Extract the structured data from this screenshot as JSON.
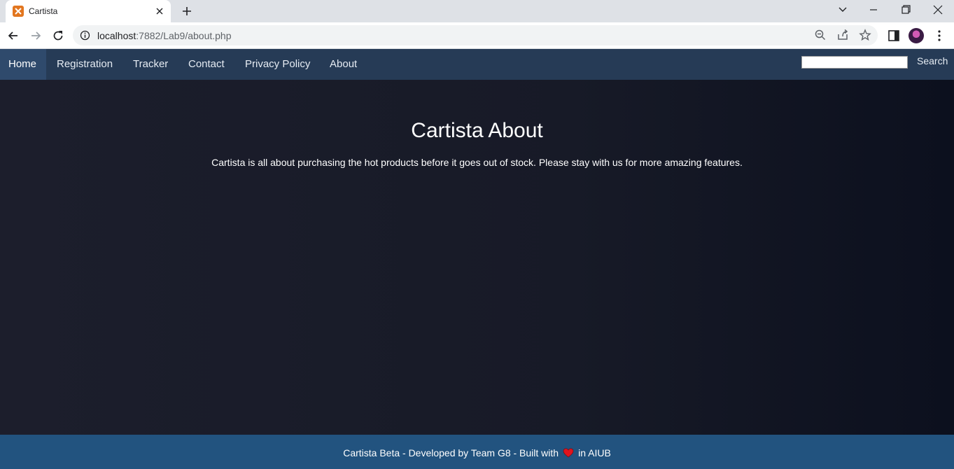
{
  "browser": {
    "tab_title": "Cartista",
    "url_host": "localhost",
    "url_rest": ":7882/Lab9/about.php"
  },
  "nav": {
    "items": [
      {
        "label": "Home"
      },
      {
        "label": "Registration"
      },
      {
        "label": "Tracker"
      },
      {
        "label": "Contact"
      },
      {
        "label": "Privacy Policy"
      },
      {
        "label": "About"
      }
    ],
    "active": "Home",
    "search_value": "",
    "search_button": "Search"
  },
  "main": {
    "title": "Cartista About",
    "description": "Cartista is all about purchasing the hot products before it goes out of stock. Please stay with us for more amazing features."
  },
  "footer": {
    "text_before": "Cartista Beta - Developed by Team G8 - Built with",
    "text_after": "in AIUB",
    "icon": "heart-icon"
  },
  "colors": {
    "nav_bg": "#263b56",
    "footer_bg": "#22537f",
    "main_bg": "#1b1d2b",
    "heart": "#e0141e"
  }
}
